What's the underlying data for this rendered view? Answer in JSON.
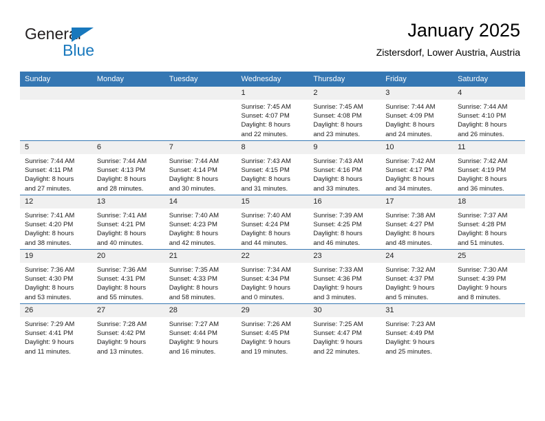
{
  "brand": {
    "name_top": "General",
    "name_bottom": "Blue",
    "accent_color": "#1878bd"
  },
  "header": {
    "title": "January 2025",
    "subtitle": "Zistersdorf, Lower Austria, Austria",
    "header_bg_color": "#3577b3",
    "daynum_bg_color": "#f0f0f0"
  },
  "weekday_headers": [
    "Sunday",
    "Monday",
    "Tuesday",
    "Wednesday",
    "Thursday",
    "Friday",
    "Saturday"
  ],
  "labels": {
    "sunrise_prefix": "Sunrise:",
    "sunset_prefix": "Sunset:",
    "daylight_prefix": "Daylight:"
  },
  "weeks": [
    [
      {
        "day": "",
        "l1": "",
        "l2": "",
        "l3": "",
        "l4": ""
      },
      {
        "day": "",
        "l1": "",
        "l2": "",
        "l3": "",
        "l4": ""
      },
      {
        "day": "",
        "l1": "",
        "l2": "",
        "l3": "",
        "l4": ""
      },
      {
        "day": "1",
        "l1": "Sunrise: 7:45 AM",
        "l2": "Sunset: 4:07 PM",
        "l3": "Daylight: 8 hours",
        "l4": "and 22 minutes."
      },
      {
        "day": "2",
        "l1": "Sunrise: 7:45 AM",
        "l2": "Sunset: 4:08 PM",
        "l3": "Daylight: 8 hours",
        "l4": "and 23 minutes."
      },
      {
        "day": "3",
        "l1": "Sunrise: 7:44 AM",
        "l2": "Sunset: 4:09 PM",
        "l3": "Daylight: 8 hours",
        "l4": "and 24 minutes."
      },
      {
        "day": "4",
        "l1": "Sunrise: 7:44 AM",
        "l2": "Sunset: 4:10 PM",
        "l3": "Daylight: 8 hours",
        "l4": "and 26 minutes."
      }
    ],
    [
      {
        "day": "5",
        "l1": "Sunrise: 7:44 AM",
        "l2": "Sunset: 4:11 PM",
        "l3": "Daylight: 8 hours",
        "l4": "and 27 minutes."
      },
      {
        "day": "6",
        "l1": "Sunrise: 7:44 AM",
        "l2": "Sunset: 4:13 PM",
        "l3": "Daylight: 8 hours",
        "l4": "and 28 minutes."
      },
      {
        "day": "7",
        "l1": "Sunrise: 7:44 AM",
        "l2": "Sunset: 4:14 PM",
        "l3": "Daylight: 8 hours",
        "l4": "and 30 minutes."
      },
      {
        "day": "8",
        "l1": "Sunrise: 7:43 AM",
        "l2": "Sunset: 4:15 PM",
        "l3": "Daylight: 8 hours",
        "l4": "and 31 minutes."
      },
      {
        "day": "9",
        "l1": "Sunrise: 7:43 AM",
        "l2": "Sunset: 4:16 PM",
        "l3": "Daylight: 8 hours",
        "l4": "and 33 minutes."
      },
      {
        "day": "10",
        "l1": "Sunrise: 7:42 AM",
        "l2": "Sunset: 4:17 PM",
        "l3": "Daylight: 8 hours",
        "l4": "and 34 minutes."
      },
      {
        "day": "11",
        "l1": "Sunrise: 7:42 AM",
        "l2": "Sunset: 4:19 PM",
        "l3": "Daylight: 8 hours",
        "l4": "and 36 minutes."
      }
    ],
    [
      {
        "day": "12",
        "l1": "Sunrise: 7:41 AM",
        "l2": "Sunset: 4:20 PM",
        "l3": "Daylight: 8 hours",
        "l4": "and 38 minutes."
      },
      {
        "day": "13",
        "l1": "Sunrise: 7:41 AM",
        "l2": "Sunset: 4:21 PM",
        "l3": "Daylight: 8 hours",
        "l4": "and 40 minutes."
      },
      {
        "day": "14",
        "l1": "Sunrise: 7:40 AM",
        "l2": "Sunset: 4:23 PM",
        "l3": "Daylight: 8 hours",
        "l4": "and 42 minutes."
      },
      {
        "day": "15",
        "l1": "Sunrise: 7:40 AM",
        "l2": "Sunset: 4:24 PM",
        "l3": "Daylight: 8 hours",
        "l4": "and 44 minutes."
      },
      {
        "day": "16",
        "l1": "Sunrise: 7:39 AM",
        "l2": "Sunset: 4:25 PM",
        "l3": "Daylight: 8 hours",
        "l4": "and 46 minutes."
      },
      {
        "day": "17",
        "l1": "Sunrise: 7:38 AM",
        "l2": "Sunset: 4:27 PM",
        "l3": "Daylight: 8 hours",
        "l4": "and 48 minutes."
      },
      {
        "day": "18",
        "l1": "Sunrise: 7:37 AM",
        "l2": "Sunset: 4:28 PM",
        "l3": "Daylight: 8 hours",
        "l4": "and 51 minutes."
      }
    ],
    [
      {
        "day": "19",
        "l1": "Sunrise: 7:36 AM",
        "l2": "Sunset: 4:30 PM",
        "l3": "Daylight: 8 hours",
        "l4": "and 53 minutes."
      },
      {
        "day": "20",
        "l1": "Sunrise: 7:36 AM",
        "l2": "Sunset: 4:31 PM",
        "l3": "Daylight: 8 hours",
        "l4": "and 55 minutes."
      },
      {
        "day": "21",
        "l1": "Sunrise: 7:35 AM",
        "l2": "Sunset: 4:33 PM",
        "l3": "Daylight: 8 hours",
        "l4": "and 58 minutes."
      },
      {
        "day": "22",
        "l1": "Sunrise: 7:34 AM",
        "l2": "Sunset: 4:34 PM",
        "l3": "Daylight: 9 hours",
        "l4": "and 0 minutes."
      },
      {
        "day": "23",
        "l1": "Sunrise: 7:33 AM",
        "l2": "Sunset: 4:36 PM",
        "l3": "Daylight: 9 hours",
        "l4": "and 3 minutes."
      },
      {
        "day": "24",
        "l1": "Sunrise: 7:32 AM",
        "l2": "Sunset: 4:37 PM",
        "l3": "Daylight: 9 hours",
        "l4": "and 5 minutes."
      },
      {
        "day": "25",
        "l1": "Sunrise: 7:30 AM",
        "l2": "Sunset: 4:39 PM",
        "l3": "Daylight: 9 hours",
        "l4": "and 8 minutes."
      }
    ],
    [
      {
        "day": "26",
        "l1": "Sunrise: 7:29 AM",
        "l2": "Sunset: 4:41 PM",
        "l3": "Daylight: 9 hours",
        "l4": "and 11 minutes."
      },
      {
        "day": "27",
        "l1": "Sunrise: 7:28 AM",
        "l2": "Sunset: 4:42 PM",
        "l3": "Daylight: 9 hours",
        "l4": "and 13 minutes."
      },
      {
        "day": "28",
        "l1": "Sunrise: 7:27 AM",
        "l2": "Sunset: 4:44 PM",
        "l3": "Daylight: 9 hours",
        "l4": "and 16 minutes."
      },
      {
        "day": "29",
        "l1": "Sunrise: 7:26 AM",
        "l2": "Sunset: 4:45 PM",
        "l3": "Daylight: 9 hours",
        "l4": "and 19 minutes."
      },
      {
        "day": "30",
        "l1": "Sunrise: 7:25 AM",
        "l2": "Sunset: 4:47 PM",
        "l3": "Daylight: 9 hours",
        "l4": "and 22 minutes."
      },
      {
        "day": "31",
        "l1": "Sunrise: 7:23 AM",
        "l2": "Sunset: 4:49 PM",
        "l3": "Daylight: 9 hours",
        "l4": "and 25 minutes."
      },
      {
        "day": "",
        "l1": "",
        "l2": "",
        "l3": "",
        "l4": ""
      }
    ]
  ]
}
